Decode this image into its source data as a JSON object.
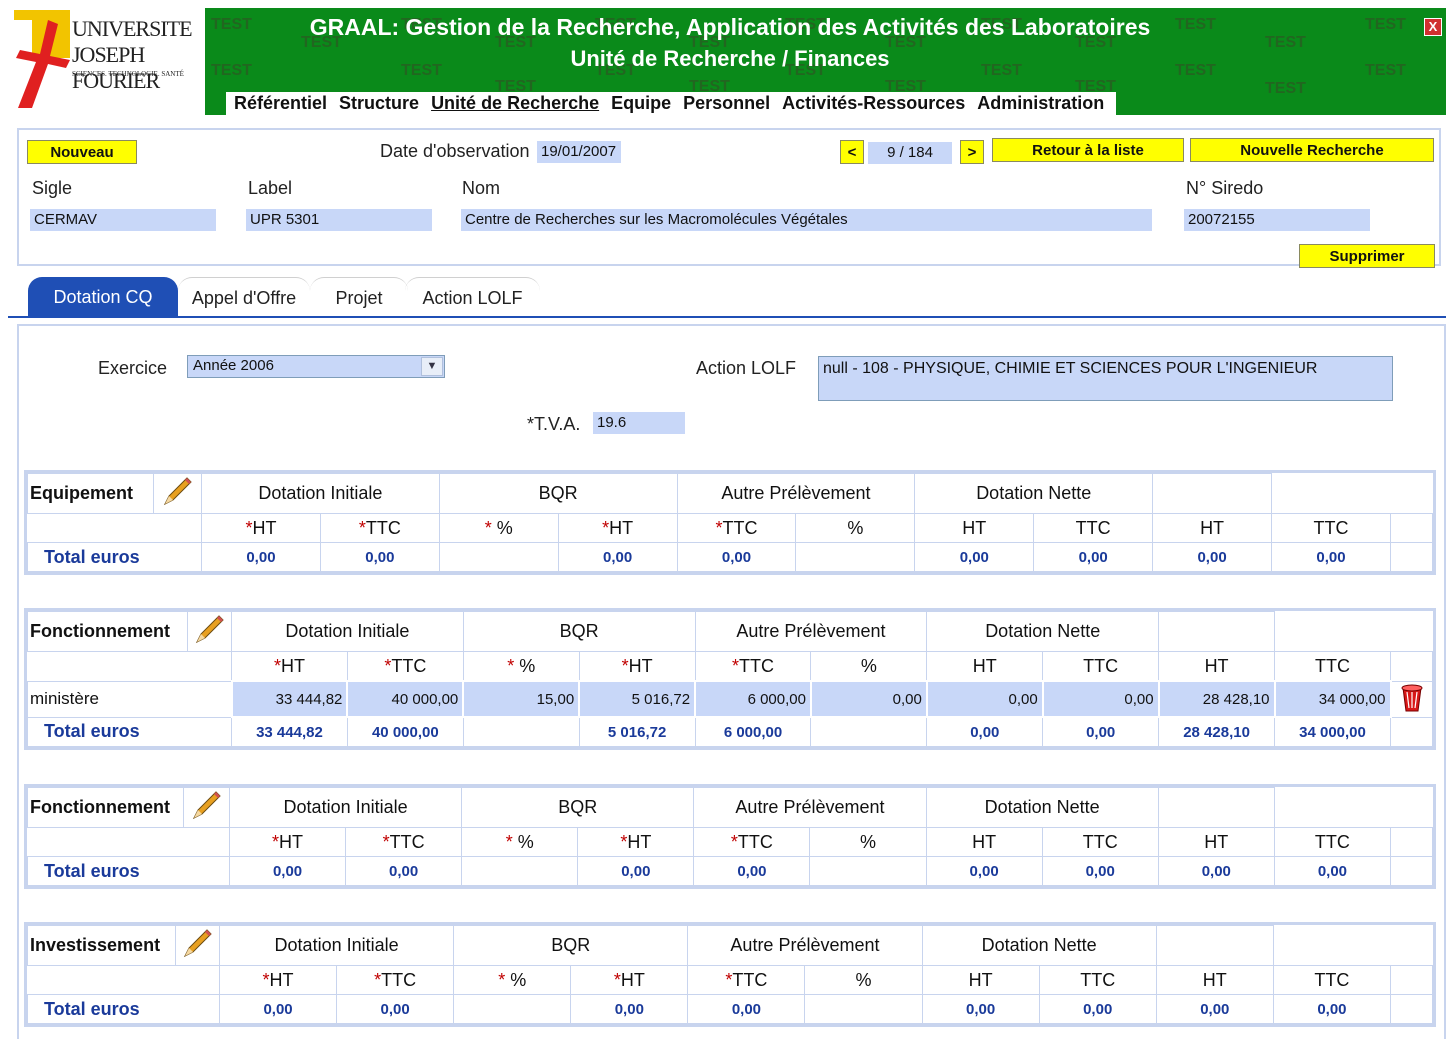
{
  "header": {
    "title_line1": "GRAAL: Gestion de la Recherche, Application des Activités des Laboratoires",
    "title_line2": "Unité de Recherche / Finances",
    "watermark": "TEST",
    "close_label": "X",
    "logo": {
      "line1": "UNIVERSITE",
      "line2": "JOSEPH FOURIER",
      "line3": "SCIENCES. TECHNOLOGIE. SANTÉ"
    },
    "menu": [
      "Référentiel",
      "Structure",
      "Unité de Recherche",
      "Equipe",
      "Personnel",
      "Activités-Ressources",
      "Administration"
    ],
    "active_menu": "Unité de Recherche",
    "accent_color": "#0a8a1a"
  },
  "form": {
    "new_button": "Nouveau",
    "observation_label": "Date d'observation",
    "observation_date": "19/01/2007",
    "prev_button": "<",
    "next_button": ">",
    "record_position": "9 / 184",
    "back_button": "Retour à la liste",
    "new_search_button": "Nouvelle Recherche",
    "delete_button": "Supprimer",
    "sigle_label": "Sigle",
    "sigle_value": "CERMAV",
    "label_label": "Label",
    "label_value": "UPR 5301",
    "nom_label": "Nom",
    "nom_value": "Centre de Recherches sur les Macromolécules Végétales",
    "siredo_label": "N° Siredo",
    "siredo_value": "20072155"
  },
  "tabs": [
    "Dotation CQ",
    "Appel d'Offre",
    "Projet",
    "Action LOLF"
  ],
  "active_tab": "Dotation CQ",
  "filters": {
    "exercice_label": "Exercice",
    "exercice_value": "Année 2006",
    "lolf_label": "Action LOLF",
    "lolf_value": "null - 108 - PHYSIQUE, CHIMIE ET SCIENCES POUR L'INGENIEUR",
    "tva_label": "*T.V.A.",
    "tva_value": "19.6"
  },
  "group_headers": [
    "Dotation Initiale",
    "BQR",
    "Autre Prélèvement",
    "Dotation Nette"
  ],
  "col_headers": [
    "*HT",
    "*TTC",
    "* %",
    "*HT",
    "*TTC",
    "%",
    "HT",
    "TTC",
    "HT",
    "TTC"
  ],
  "total_label": "Total euros",
  "sections": [
    {
      "name": "Equipement",
      "rows": [],
      "totals": [
        "0,00",
        "0,00",
        "",
        "0,00",
        "0,00",
        "",
        "0,00",
        "0,00",
        "0,00",
        "0,00"
      ]
    },
    {
      "name": "Fonctionnement",
      "rows": [
        {
          "label": "ministère",
          "values": [
            "33 444,82",
            "40 000,00",
            "15,00",
            "5 016,72",
            "6 000,00",
            "0,00",
            "0,00",
            "0,00",
            "28 428,10",
            "34 000,00"
          ]
        }
      ],
      "totals": [
        "33 444,82",
        "40 000,00",
        "",
        "5 016,72",
        "6 000,00",
        "",
        "0,00",
        "0,00",
        "28 428,10",
        "34 000,00"
      ]
    },
    {
      "name": "Fonctionnement",
      "rows": [],
      "totals": [
        "0,00",
        "0,00",
        "",
        "0,00",
        "0,00",
        "",
        "0,00",
        "0,00",
        "0,00",
        "0,00"
      ]
    },
    {
      "name": "Investissement",
      "rows": [],
      "totals": [
        "0,00",
        "0,00",
        "",
        "0,00",
        "0,00",
        "",
        "0,00",
        "0,00",
        "0,00",
        "0,00"
      ]
    }
  ]
}
